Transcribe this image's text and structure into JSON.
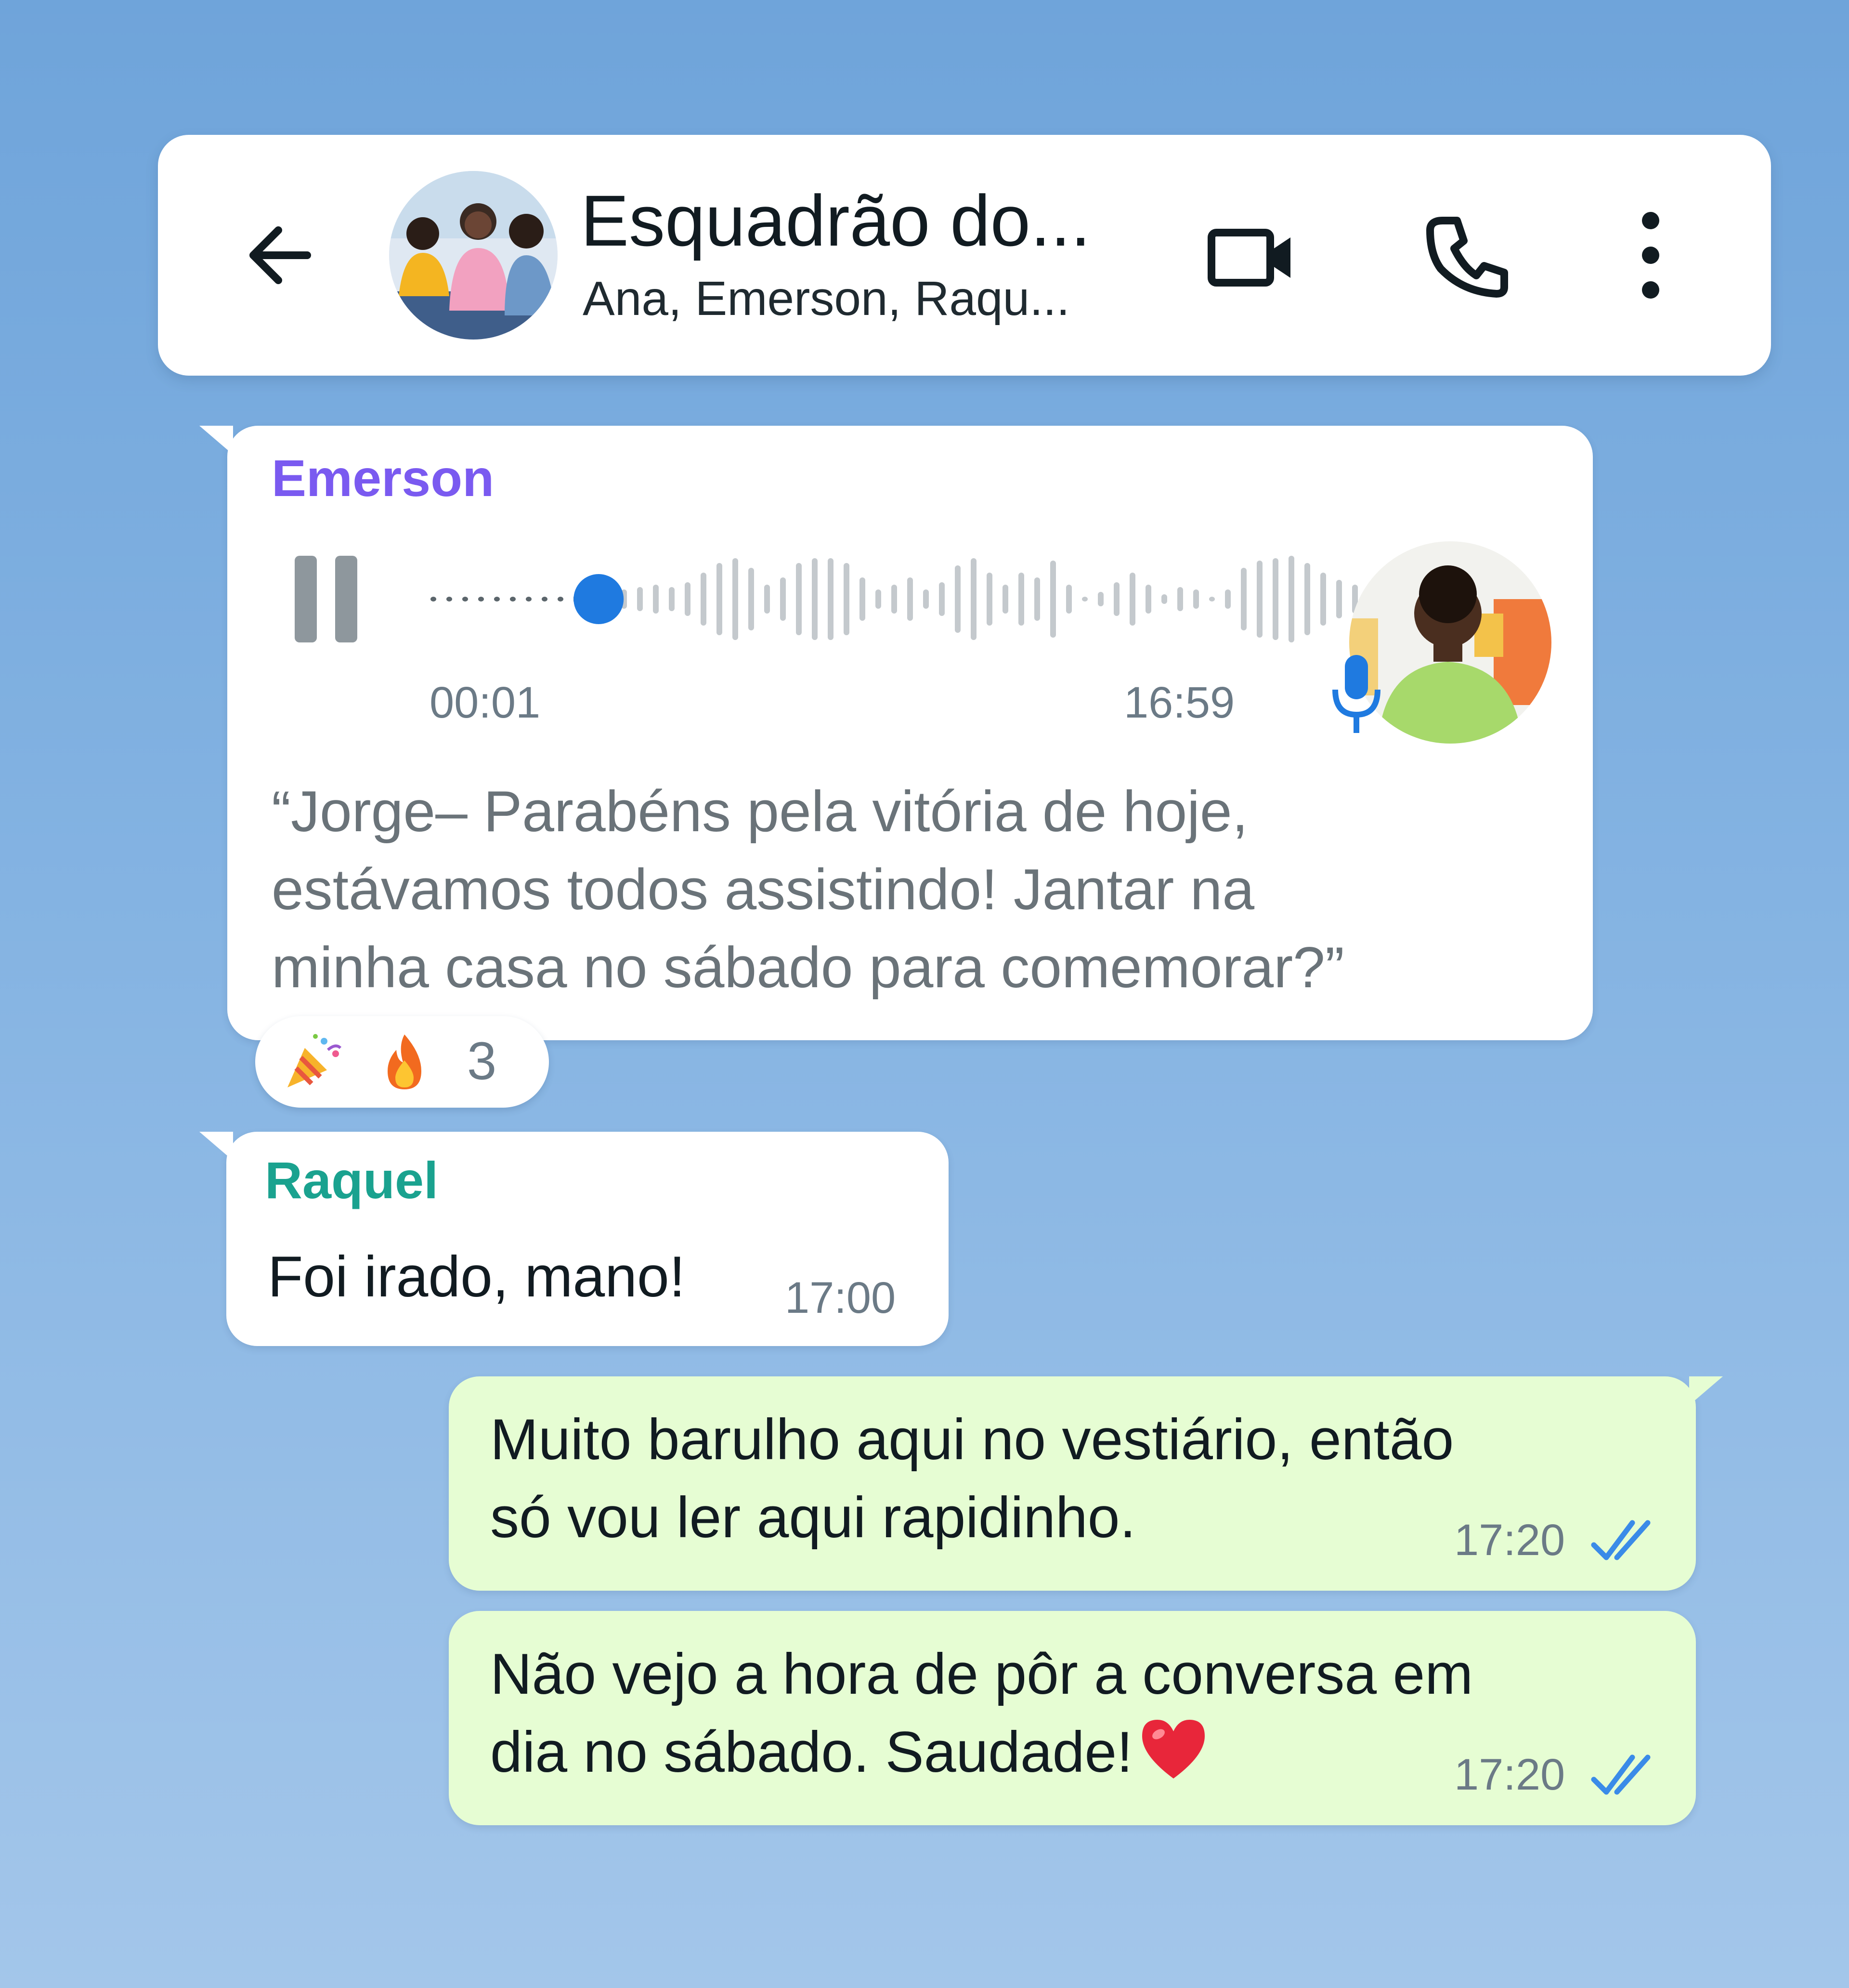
{
  "header": {
    "title": "Esquadrão do...",
    "subtitle": "Ana, Emerson, Raqu..."
  },
  "voice_message": {
    "sender": "Emerson",
    "played_time": "00:01",
    "sent_time": "16:59",
    "progress": 0.16,
    "transcript": "“Jorge– Parabéns pela vitória de hoje,\nestávamos todos assistindo! Jantar na\nminha casa no sábado para comemorar?”",
    "reactions": {
      "emojis": [
        "party-popper",
        "fire"
      ],
      "count": "3"
    }
  },
  "messages": [
    {
      "sender": "Raquel",
      "text": "Foi irado, mano!",
      "time": "17:00"
    },
    {
      "text": "Muito barulho aqui no vestiário, então\nsó vou ler aqui rapidinho.",
      "time": "17:20",
      "status": "read"
    },
    {
      "text": "Não vejo a hora de pôr a conversa em\ndia no sábado. Saudade!",
      "time": "17:20",
      "status": "read",
      "emoji": "red-heart"
    }
  ],
  "colors": {
    "background_top": "#6fa4da",
    "background_bottom": "#a3c6ea",
    "incoming_bubble": "#ffffff",
    "outgoing_bubble": "#e6fdd3",
    "sender_emerson": "#7a5af0",
    "sender_raquel": "#1aa28f",
    "accent_blue": "#1f7ae0",
    "read_ticks": "#3a8be8"
  },
  "icons": {
    "back": "arrow-left-icon",
    "video": "video-camera-icon",
    "call": "phone-icon",
    "menu": "more-vertical-icon",
    "pause": "pause-icon",
    "mic": "microphone-icon",
    "ticks": "double-check-icon"
  }
}
